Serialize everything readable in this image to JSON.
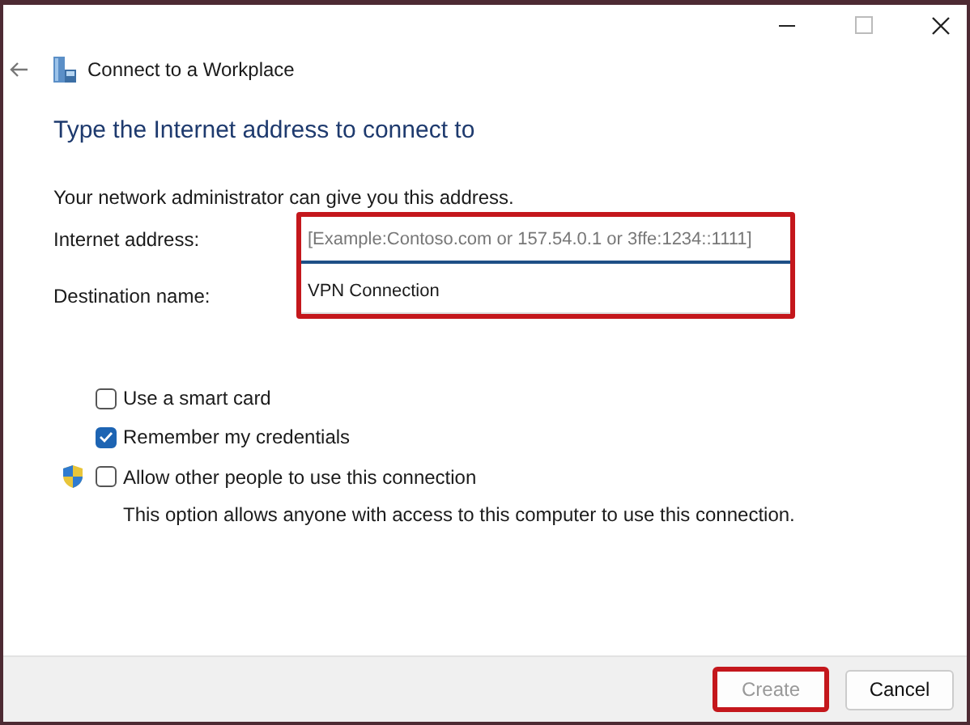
{
  "window": {
    "title": "Connect to a Workplace"
  },
  "heading": "Type the Internet address to connect to",
  "intro": "Your network administrator can give you this address.",
  "fields": [
    {
      "label": "Internet address:",
      "placeholder": "[Example:Contoso.com or 157.54.0.1 or 3ffe:1234::1111]",
      "focused": true
    },
    {
      "label": "Destination name:",
      "value": "VPN Connection",
      "focused": false
    }
  ],
  "options": [
    {
      "label": "Use a smart card",
      "checked": false,
      "shield": false
    },
    {
      "label": "Remember my credentials",
      "checked": true,
      "shield": false
    },
    {
      "label": "Allow other people to use this connection",
      "checked": false,
      "shield": true,
      "note": "This option allows anyone with access to this computer to use this connection."
    }
  ],
  "buttons": [
    {
      "label": "Create",
      "disabled": true,
      "highlighted": true
    },
    {
      "label": "Cancel",
      "disabled": false,
      "highlighted": false
    }
  ]
}
